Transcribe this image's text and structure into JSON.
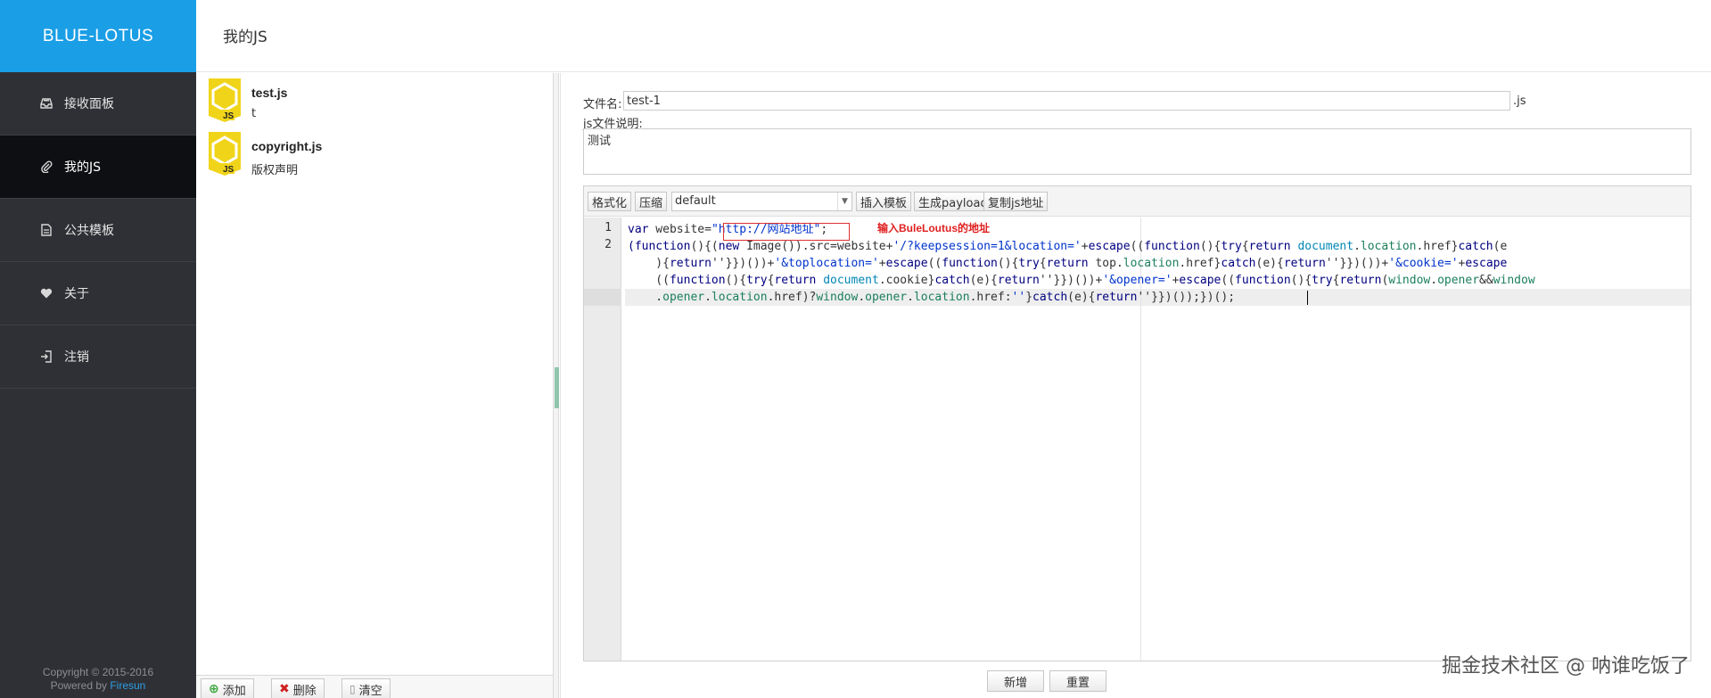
{
  "brand": "BLUE-LOTUS",
  "header": {
    "title": "我的JS"
  },
  "sidebar": {
    "items": [
      {
        "label": "接收面板",
        "icon": "inbox-icon"
      },
      {
        "label": "我的JS",
        "icon": "paperclip-icon",
        "active": true
      },
      {
        "label": "公共模板",
        "icon": "file-icon"
      },
      {
        "label": "关于",
        "icon": "heart-icon"
      },
      {
        "label": "注销",
        "icon": "logout-icon"
      }
    ],
    "copyright": "Copyright © 2015-2016",
    "powered_prefix": "Powered by",
    "powered_link": "Firesun"
  },
  "files": [
    {
      "name": "test.js",
      "desc": "t"
    },
    {
      "name": "copyright.js",
      "desc": "版权声明"
    }
  ],
  "file_toolbar": {
    "add": "添加",
    "delete": "删除",
    "clear": "清空"
  },
  "form": {
    "filename_label": "文件名:",
    "filename_value": "test-1",
    "filename_suffix": ".js",
    "desc_label": "js文件说明:",
    "desc_value": "测试"
  },
  "editor_toolbar": {
    "format": "格式化",
    "compress": "压缩",
    "template_selected": "default",
    "insert_template": "插入模板",
    "generate_payload": "生成payload",
    "copy_js_url": "复制js地址"
  },
  "code": {
    "line_numbers": [
      "1",
      "2"
    ],
    "annotation": "输入BuleLoutus的地址"
  },
  "bottom_buttons": {
    "new": "新增",
    "reset": "重置"
  },
  "watermark": "掘金技术社区 @ 呐谁吃饭了",
  "colors": {
    "brand": "#1a9ee6",
    "sidebar_bg": "#2f3035",
    "sidebar_active": "#0e0f12",
    "annotation": "#e02020"
  }
}
